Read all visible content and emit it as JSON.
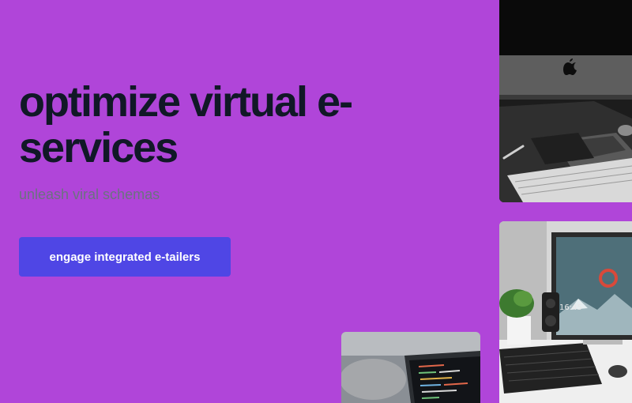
{
  "hero": {
    "title": "optimize virtual e-services",
    "subtitle": "unleash viral schemas",
    "cta_label": "engage integrated e-tailers"
  },
  "images": [
    {
      "name": "imac-desk-photo",
      "depicts": "iMac with keyboard, iPhone and tablet on desk"
    },
    {
      "name": "monitor-desk-photo",
      "depicts": "monitor, keyboard, speaker and plant on desk"
    },
    {
      "name": "laptop-couch-photo",
      "depicts": "laptop with code on a couch"
    }
  ],
  "colors": {
    "background": "#b045d9",
    "title": "#111827",
    "subtitle": "#6b7280",
    "button": "#4f46e5",
    "button_text": "#ffffff"
  }
}
